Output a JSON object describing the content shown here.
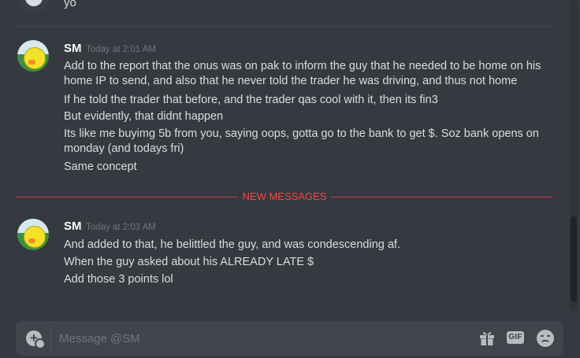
{
  "previous_message": {
    "text": "yo"
  },
  "groups": [
    {
      "username": "SM",
      "timestamp": "Today at 2:01 AM",
      "messages": [
        "Add to the report that the onus was on pak to inform the guy that he needed to be home on his home IP to send, and also that he never told the trader he was driving, and thus not home",
        "If he told the trader that before, and the trader qas cool with it, then its fin3",
        "But evidently, that didnt happen",
        "Its like me buyimg 5b from you, saying oops, gotta go to the bank to get $. Soz bank opens on monday (and todays fri)",
        "Same concept"
      ]
    },
    {
      "username": "SM",
      "timestamp": "Today at 2:03 AM",
      "messages": [
        "And added to that, he belittled the guy, and was condescending af.",
        "When the guy asked about his ALREADY LATE $",
        "Add those 3 points lol"
      ]
    }
  ],
  "divider": {
    "label": "NEW MESSAGES"
  },
  "composer": {
    "placeholder": "Message @SM",
    "gif_label": "GIF"
  },
  "icons": {
    "attach": "plus-circle-icon",
    "gift": "gift-icon",
    "gif": "gif-icon",
    "emoji": "emoji-face-icon"
  },
  "colors": {
    "background": "#36393f",
    "composer": "#40444b",
    "new_messages": "#f04747",
    "username": "#ffffff",
    "timestamp": "#72767d",
    "text": "#dcddde"
  }
}
